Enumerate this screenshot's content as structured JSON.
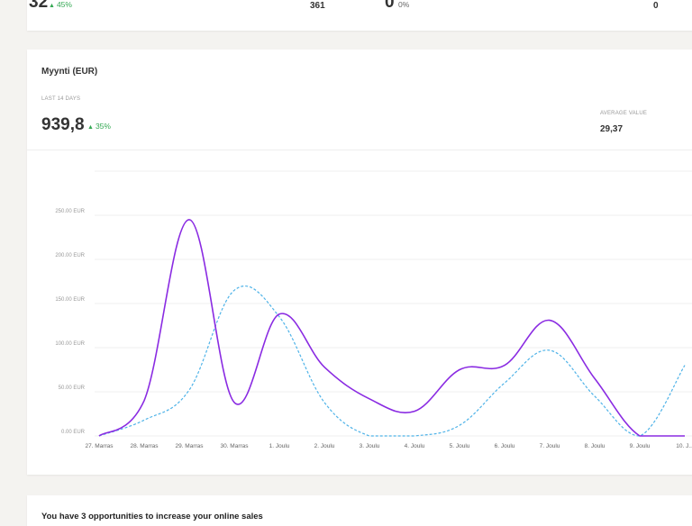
{
  "top_stats": {
    "stat1_value": "32",
    "stat1_change": "45%",
    "stat2_value": "361",
    "stat3_value": "0",
    "stat3_change": "0%",
    "stat4_value": "0"
  },
  "sales": {
    "title": "Myynti (EUR)",
    "period_label": "LAST 14 DAYS",
    "total": "939,8",
    "change": "35%",
    "average_label": "AVERAGE VALUE",
    "average_value": "29,37"
  },
  "colors": {
    "current": "#8a2be2",
    "previous": "#4fb3e8",
    "positive": "#34a853"
  },
  "chart_data": {
    "type": "line",
    "categories": [
      "27. Marras",
      "28. Marras",
      "29. Marras",
      "30. Marras",
      "1. Joulu",
      "2. Joulu",
      "3. Joulu",
      "4. Joulu",
      "5. Joulu",
      "6. Joulu",
      "7. Joulu",
      "8. Joulu",
      "9. Joulu",
      "10. J..."
    ],
    "ylim": [
      0,
      300
    ],
    "yticks": [
      "0.00 EUR",
      "50.00 EUR",
      "100.00 EUR",
      "150.00 EUR",
      "200.00 EUR",
      "250.00 EUR"
    ],
    "series": [
      {
        "style": "solid",
        "values": [
          0,
          40,
          245,
          38,
          138,
          78,
          42,
          28,
          75,
          80,
          131,
          65,
          0,
          0
        ]
      },
      {
        "style": "dashed",
        "values": [
          0,
          18,
          52,
          165,
          135,
          38,
          0,
          0,
          12,
          60,
          97,
          45,
          0,
          80
        ]
      }
    ]
  },
  "opportunities": {
    "text": "You have 3 opportunities to increase your online sales"
  }
}
